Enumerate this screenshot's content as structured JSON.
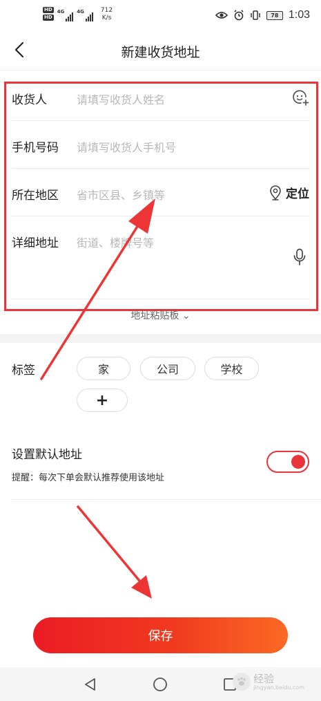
{
  "status_bar": {
    "hd1": "HD",
    "hd2": "HD",
    "sim1": "4G",
    "sim2": "4G",
    "net_speed": "712",
    "net_unit": "K/s",
    "battery": "78",
    "time": "1:03"
  },
  "header": {
    "title": "新建收货地址"
  },
  "form": {
    "receiver_label": "收货人",
    "receiver_placeholder": "请填写收货人姓名",
    "phone_label": "手机号码",
    "phone_placeholder": "请填写收货人手机号",
    "region_label": "所在地区",
    "region_placeholder": "省市区县、乡镇等",
    "locate_label": "定位",
    "detail_label": "详细地址",
    "detail_placeholder": "街道、楼牌号等"
  },
  "paste_board": "地址粘贴板",
  "tags": {
    "label": "标签",
    "items": [
      "家",
      "公司",
      "学校"
    ],
    "add": "+"
  },
  "default_address": {
    "title": "设置默认地址",
    "hint": "提醒：每次下单会默认推荐使用该地址",
    "enabled": true
  },
  "save_label": "保存",
  "watermark": {
    "text": "经验",
    "url": "jingyan.baidu.com"
  },
  "colors": {
    "accent": "#e8343a",
    "button_start": "#ec1c24",
    "button_end": "#fb6a24"
  }
}
